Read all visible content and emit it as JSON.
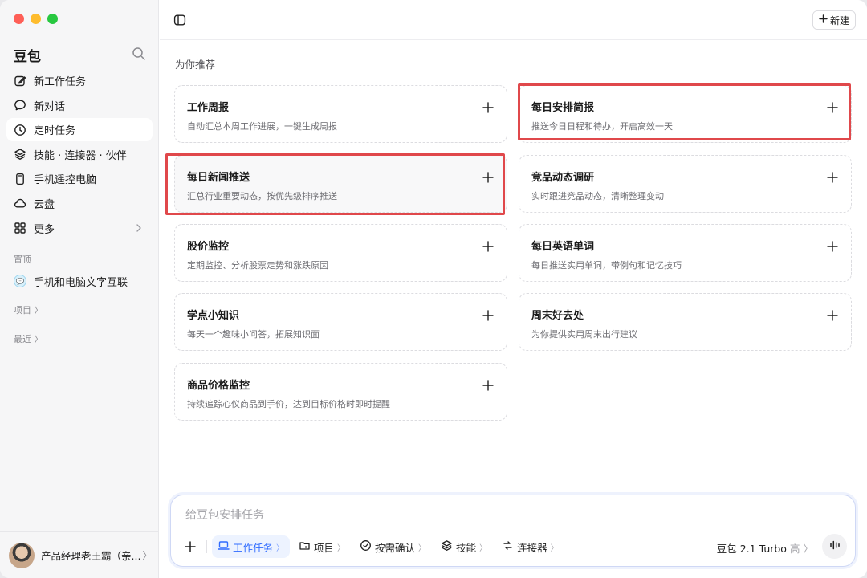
{
  "sidebar": {
    "app_title": "豆包",
    "nav": [
      {
        "label": "新工作任务",
        "icon": "edit-icon"
      },
      {
        "label": "新对话",
        "icon": "chat-bubble-icon"
      },
      {
        "label": "定时任务",
        "icon": "clock-icon",
        "active": true
      },
      {
        "label": "技能 · 连接器 · 伙伴",
        "icon": "layers-icon"
      },
      {
        "label": "手机遥控电脑",
        "icon": "phone-icon"
      },
      {
        "label": "云盘",
        "icon": "cloud-icon"
      },
      {
        "label": "更多",
        "icon": "grid-icon"
      }
    ],
    "pinned_label": "置顶",
    "pinned_item": "手机和电脑文字互联",
    "projects_label": "项目 〉",
    "recent_label": "最近 〉",
    "profile_name": "产品经理老王霸（亲...",
    "profile_chevron": "〉"
  },
  "topbar": {
    "new_label": "新建"
  },
  "main": {
    "section_title": "为你推荐",
    "cards": [
      {
        "title": "工作周报",
        "desc": "自动汇总本周工作进展，一键生成周报"
      },
      {
        "title": "每日安排简报",
        "desc": "推送今日日程和待办，开启高效一天"
      },
      {
        "title": "每日新闻推送",
        "desc": "汇总行业重要动态，按优先级排序推送"
      },
      {
        "title": "竞品动态调研",
        "desc": "实时跟进竞品动态，清晰整理变动"
      },
      {
        "title": "股价监控",
        "desc": "定期监控、分析股票走势和涨跌原因"
      },
      {
        "title": "每日英语单词",
        "desc": "每日推送实用单词，带例句和记忆技巧"
      },
      {
        "title": "学点小知识",
        "desc": "每天一个趣味小问答，拓展知识面"
      },
      {
        "title": "周末好去处",
        "desc": "为你提供实用周末出行建议"
      },
      {
        "title": "商品价格监控",
        "desc": "持续追踪心仪商品到手价，达到目标价格时即时提醒"
      }
    ]
  },
  "composer": {
    "placeholder": "给豆包安排任务",
    "chips": [
      {
        "label": "工作任务",
        "icon": "laptop-icon",
        "arrow": "〉",
        "active": true
      },
      {
        "label": "项目",
        "icon": "folder-icon",
        "arrow": "〉"
      },
      {
        "label": "按需确认",
        "icon": "check-circle-icon",
        "arrow": "〉"
      },
      {
        "label": "技能",
        "icon": "layers-icon",
        "arrow": "〉"
      },
      {
        "label": "连接器",
        "icon": "link-icon",
        "arrow": "〉"
      }
    ],
    "model_name": "豆包 2.1 Turbo",
    "model_level": "高",
    "model_chevron": "〉"
  },
  "colors": {
    "accent": "#2f6bff",
    "highlight_box": "#e0484b",
    "sidebar_bg": "#f6f6f7"
  }
}
